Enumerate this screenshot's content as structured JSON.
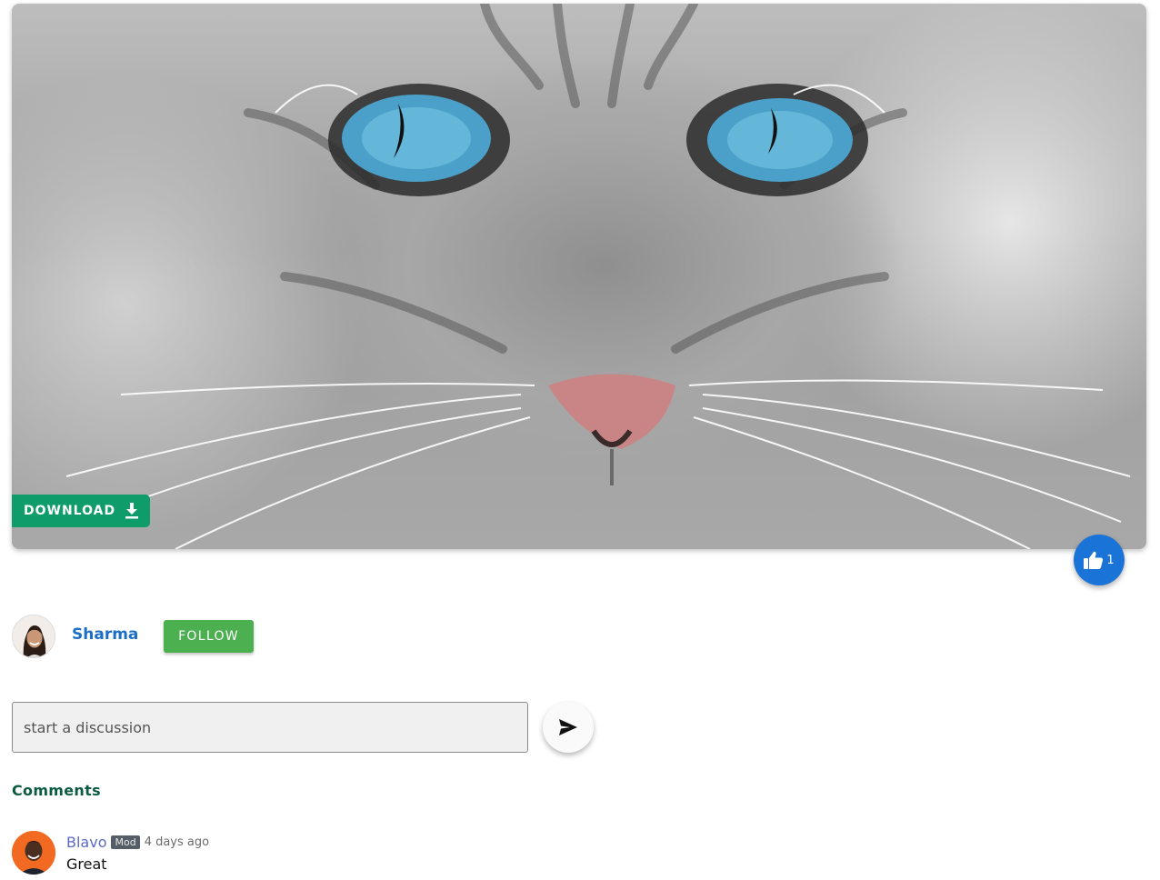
{
  "hero": {
    "download_label": "DOWNLOAD",
    "download_icon": "download-icon",
    "accent": "#0d9c6a"
  },
  "likes": {
    "icon": "thumbs-up-icon",
    "count": "1",
    "color": "#1a73d6"
  },
  "author": {
    "name": "Sharma",
    "follow_label": "FOLLOW",
    "follow_color": "#4caf50"
  },
  "discussion": {
    "placeholder": "start a discussion",
    "value": "",
    "send_icon": "send-icon"
  },
  "comments": {
    "heading": "Comments",
    "items": [
      {
        "user": "Blavo",
        "badge": "Mod",
        "time": "4 days ago",
        "text": "Great"
      }
    ]
  }
}
